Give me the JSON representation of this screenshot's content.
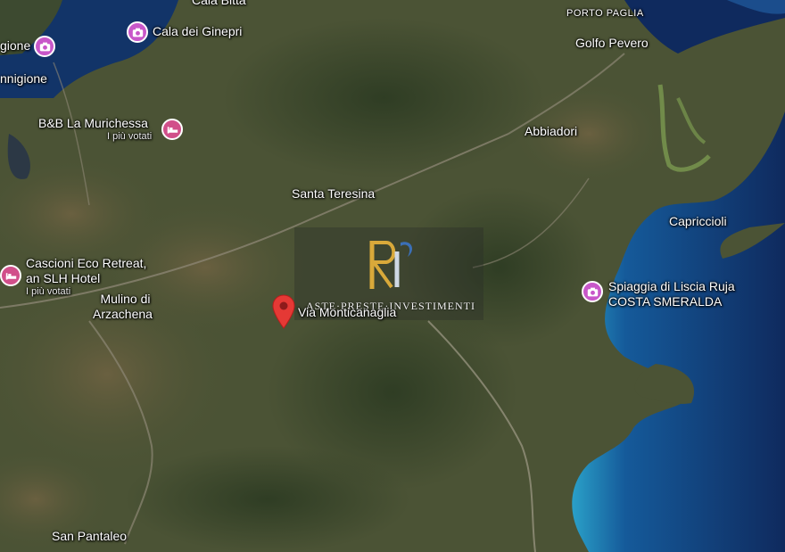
{
  "map": {
    "type": "satellite",
    "colors": {
      "land": "#4a5234",
      "sea_deep": "#0f2a5e",
      "sea_shallow": "#2aa0c8",
      "poi": "#c857c9",
      "pin": "#e53935"
    }
  },
  "places": {
    "cala_bitta": "Cala Bitta",
    "porto_paglia": "PORTO PAGLIA",
    "cala_dei_ginepri": "Cala dei Ginepri",
    "golfo_pevero": "Golfo Pevero",
    "gione": "gione",
    "nnigione": "nnigione",
    "abbiadori": "Abbiadori",
    "santa_teresina": "Santa Teresina",
    "capriccioli": "Capriccioli",
    "mulino_line1": "Mulino di",
    "mulino_line2": "Arzachena",
    "san_pantaleo": "San Pantaleo",
    "via_monticanaglia": "Via Monticanaglia"
  },
  "pois": {
    "bb_name": "B&B La Murichessa",
    "bb_sub": "I più votati",
    "cascioni_line1": "Cascioni Eco Retreat,",
    "cascioni_line2": "an SLH Hotel",
    "cascioni_sub": "I più votati",
    "spiaggia_line1": "Spiaggia di Liscia Ruja",
    "spiaggia_line2": "COSTA SMERALDA"
  },
  "icons": {
    "poi_camera": "camera-icon",
    "poi_bed": "bed-icon",
    "pin": "map-pin-icon"
  },
  "watermark": {
    "logo_letters": "RI",
    "text": "ASTE·PRESTE·INVESTIMENTI"
  }
}
